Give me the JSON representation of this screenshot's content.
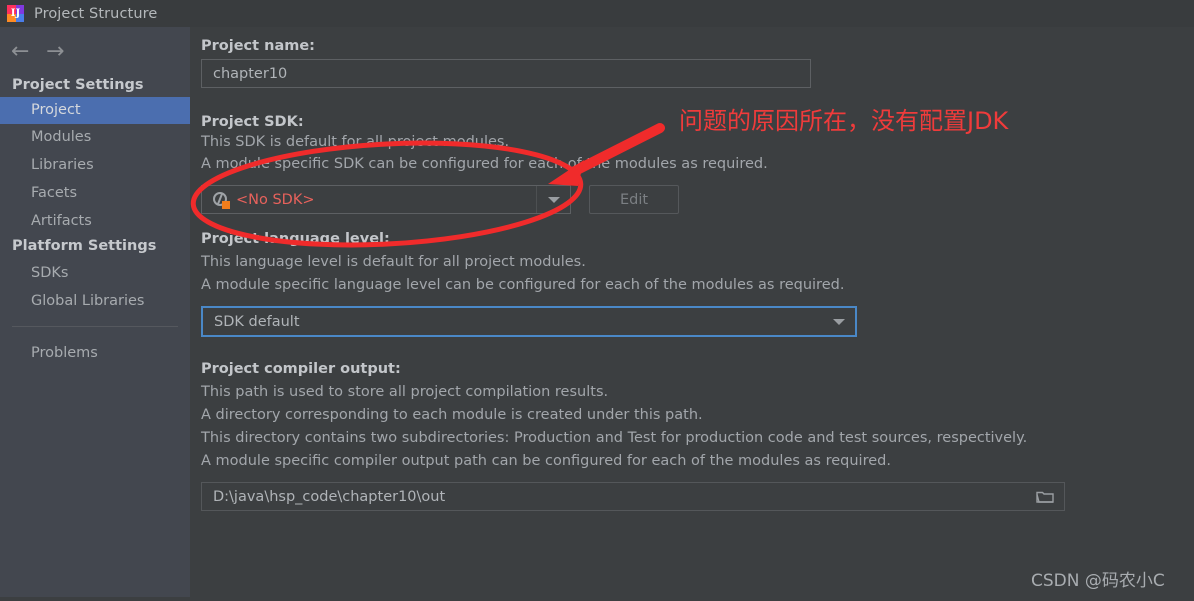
{
  "window": {
    "title": "Project Structure",
    "app_icon": "intellij-idea-icon",
    "logo_glyph": "IJ"
  },
  "navigation": {
    "back_icon": "←",
    "forward_icon": "→"
  },
  "sidebar": {
    "groups": [
      {
        "header": "Project Settings",
        "items": [
          {
            "label": "Project",
            "selected": true
          },
          {
            "label": "Modules",
            "selected": false
          },
          {
            "label": "Libraries",
            "selected": false
          },
          {
            "label": "Facets",
            "selected": false
          },
          {
            "label": "Artifacts",
            "selected": false
          }
        ]
      },
      {
        "header": "Platform Settings",
        "items": [
          {
            "label": "SDKs",
            "selected": false
          },
          {
            "label": "Global Libraries",
            "selected": false
          }
        ]
      }
    ],
    "problems": {
      "label": "Problems",
      "selected": false
    }
  },
  "main": {
    "project_name": {
      "label": "Project name:",
      "value": "chapter10",
      "placeholder": ""
    },
    "project_sdk": {
      "label": "Project SDK:",
      "description": [
        "This SDK is default for all project modules.",
        "A module specific SDK can be configured for each of the modules as required."
      ],
      "selected": "<No SDK>",
      "selected_color": "#e8625c",
      "icon": "sdk-globe-icon",
      "edit_button": "Edit",
      "edit_disabled": true
    },
    "language_level": {
      "label": "Project language level:",
      "description": [
        "This language level is default for all project modules.",
        "A module specific language level can be configured for each of the modules as required."
      ],
      "selected": "SDK default",
      "focused": true
    },
    "compiler_output": {
      "label": "Project compiler output:",
      "description": [
        "This path is used to store all project compilation results.",
        "A directory corresponding to each module is created under this path.",
        "This directory contains two subdirectories: Production and Test for production code and test sources, respectively.",
        "A module specific compiler output path can be configured for each of the modules as required."
      ],
      "value": "D:\\java\\hsp_code\\chapter10\\out",
      "browse_icon": "folder-icon"
    }
  },
  "annotation": {
    "text": "问题的原因所在，没有配置JDK",
    "color": "#ef3b3b",
    "ellipse_target": "project-sdk-combobox",
    "arrow_target": "project-sdk-combobox"
  },
  "watermark": {
    "text": "CSDN @码农小C"
  },
  "colors": {
    "sidebar_bg": "#43474f",
    "main_bg": "#3c3f41",
    "titlebar_bg": "#393c3e",
    "selection_blue": "#4b6eaf",
    "focus_blue": "#4a88c7",
    "annotation_red": "#ef3b3b",
    "sdk_warning_red": "#e8625c",
    "sdk_badge_orange": "#f07d1c"
  }
}
